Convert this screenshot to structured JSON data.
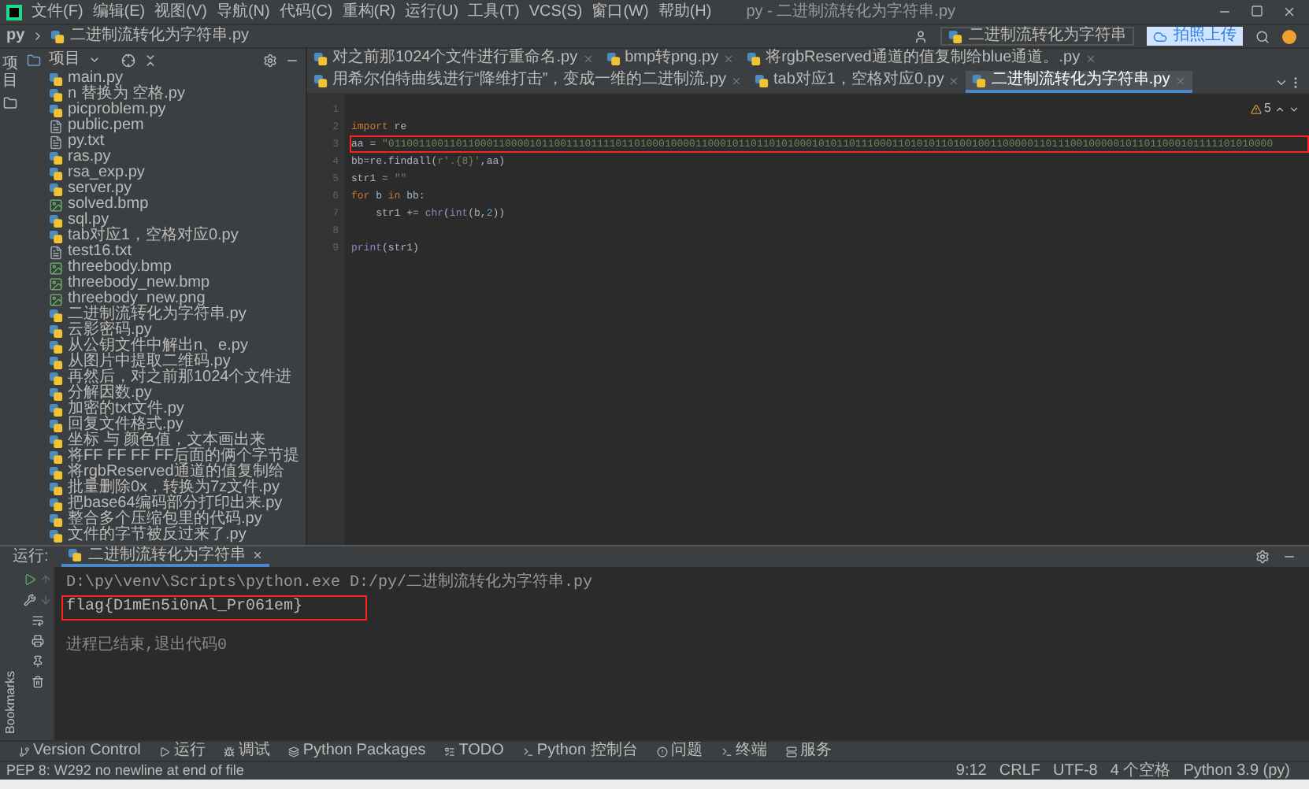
{
  "window": {
    "title": "py - 二进制流转化为字符串.py",
    "menu": [
      "文件(F)",
      "编辑(E)",
      "视图(V)",
      "导航(N)",
      "代码(C)",
      "重构(R)",
      "运行(U)",
      "工具(T)",
      "VCS(S)",
      "窗口(W)",
      "帮助(H)"
    ]
  },
  "breadcrumb": [
    "py",
    "二进制流转化为字符串.py"
  ],
  "toolbar": {
    "run_config": "二进制流转化为字符串",
    "upload_button": "拍照上传"
  },
  "side_stripe": {
    "top": "项目",
    "bottom": "Bookmarks"
  },
  "project_panel": {
    "title": "项目",
    "items": [
      {
        "name": "main.py",
        "kind": "py"
      },
      {
        "name": "n 替换为 空格.py",
        "kind": "py"
      },
      {
        "name": "picproblem.py",
        "kind": "py"
      },
      {
        "name": "public.pem",
        "kind": "text"
      },
      {
        "name": "py.txt",
        "kind": "text"
      },
      {
        "name": "ras.py",
        "kind": "py"
      },
      {
        "name": "rsa_exp.py",
        "kind": "py"
      },
      {
        "name": "server.py",
        "kind": "py"
      },
      {
        "name": "solved.bmp",
        "kind": "image"
      },
      {
        "name": "sql.py",
        "kind": "py"
      },
      {
        "name": "tab对应1，空格对应0.py",
        "kind": "py"
      },
      {
        "name": "test16.txt",
        "kind": "text"
      },
      {
        "name": "threebody.bmp",
        "kind": "image"
      },
      {
        "name": "threebody_new.bmp",
        "kind": "image"
      },
      {
        "name": "threebody_new.png",
        "kind": "image"
      },
      {
        "name": "二进制流转化为字符串.py",
        "kind": "py"
      },
      {
        "name": "云影密码.py",
        "kind": "py"
      },
      {
        "name": "从公钥文件中解出n、e.py",
        "kind": "py"
      },
      {
        "name": "从图片中提取二维码.py",
        "kind": "py"
      },
      {
        "name": "再然后，对之前那1024个文件进",
        "kind": "py"
      },
      {
        "name": "分解因数.py",
        "kind": "py"
      },
      {
        "name": "加密的txt文件.py",
        "kind": "py"
      },
      {
        "name": "回复文件格式.py",
        "kind": "py"
      },
      {
        "name": "坐标 与 颜色值，文本画出来",
        "kind": "py"
      },
      {
        "name": "将FF FF FF FF后面的俩个字节提",
        "kind": "py"
      },
      {
        "name": "将rgbReserved通道的值复制给",
        "kind": "py"
      },
      {
        "name": "批量删除0x，转换为7z文件.py",
        "kind": "py"
      },
      {
        "name": "把base64编码部分打印出来.py",
        "kind": "py"
      },
      {
        "name": "整合多个压缩包里的代码.py",
        "kind": "py"
      },
      {
        "name": "文件的字节被反过来了.py",
        "kind": "py"
      }
    ]
  },
  "tabs": [
    {
      "label": "对之前那1024个文件进行重命名.py",
      "selected": false
    },
    {
      "label": "bmp转png.py",
      "selected": false
    },
    {
      "label": "将rgbReserved通道的值复制给blue通道。.py",
      "selected": false
    },
    {
      "label": "用希尔伯特曲线进行“降维打击”，变成一维的二进制流.py",
      "selected": false
    },
    {
      "label": "tab对应1，空格对应0.py",
      "selected": false
    },
    {
      "label": "二进制流转化为字符串.py",
      "selected": true
    }
  ],
  "editor": {
    "inspections": "5",
    "lines": [
      {
        "number": "1",
        "boxed": false
      },
      {
        "number": "2",
        "boxed": false,
        "tokens": [
          {
            "kind": "kw",
            "text": "import"
          },
          {
            "kind": "plain",
            "text": " re"
          }
        ]
      },
      {
        "number": "3",
        "boxed": true,
        "tokens": [
          {
            "kind": "plain",
            "text": "aa = "
          },
          {
            "kind": "str",
            "text": "\"011001100110110001100001011001110111101101000100001100010110110101000101011011100011010101101001001100000110111001000001011011000101111101010000"
          }
        ]
      },
      {
        "number": "4",
        "boxed": false,
        "tokens": [
          {
            "kind": "plain",
            "text": "bb=re.findall("
          },
          {
            "kind": "str",
            "text": "r'.{8}'"
          },
          {
            "kind": "plain",
            "text": ",aa)"
          }
        ]
      },
      {
        "number": "5",
        "boxed": false,
        "tokens": [
          {
            "kind": "plain",
            "text": "str1 = "
          },
          {
            "kind": "str",
            "text": "\"\""
          }
        ]
      },
      {
        "number": "6",
        "boxed": false,
        "tokens": [
          {
            "kind": "kw",
            "text": "for"
          },
          {
            "kind": "plain",
            "text": " b "
          },
          {
            "kind": "kw",
            "text": "in"
          },
          {
            "kind": "plain",
            "text": " bb:"
          }
        ]
      },
      {
        "number": "7",
        "boxed": false,
        "tokens": [
          {
            "kind": "plain",
            "text": "    str1 += "
          },
          {
            "kind": "fn",
            "text": "chr"
          },
          {
            "kind": "plain",
            "text": "("
          },
          {
            "kind": "fn",
            "text": "int"
          },
          {
            "kind": "plain",
            "text": "(b,"
          },
          {
            "kind": "num",
            "text": "2"
          },
          {
            "kind": "plain",
            "text": "))"
          }
        ]
      },
      {
        "number": "8",
        "boxed": false
      },
      {
        "number": "9",
        "boxed": false,
        "tokens": [
          {
            "kind": "fn",
            "text": "print"
          },
          {
            "kind": "plain",
            "text": "(str1)"
          }
        ]
      }
    ]
  },
  "run_panel": {
    "label": "运行:",
    "tab": "二进制流转化为字符串",
    "output": [
      {
        "kind": "command",
        "boxed": false,
        "text": "D:\\py\\venv\\Scripts\\python.exe D:/py/二进制流转化为字符串.py"
      },
      {
        "kind": "stdout",
        "boxed": true,
        "text": "flag{D1mEn5i0nAl_Pr061em}"
      },
      {
        "kind": "exit",
        "boxed": false,
        "text": "进程已结束,退出代码0"
      }
    ]
  },
  "tool_windows": [
    "Version Control",
    "运行",
    "调试",
    "Python Packages",
    "TODO",
    "Python 控制台",
    "问题",
    "终端",
    "服务"
  ],
  "status_bar": {
    "message": "PEP 8: W292 no newline at end of file",
    "items": [
      "9:12",
      "CRLF",
      "UTF-8",
      "4 个空格",
      "Python 3.9 (py)"
    ]
  }
}
